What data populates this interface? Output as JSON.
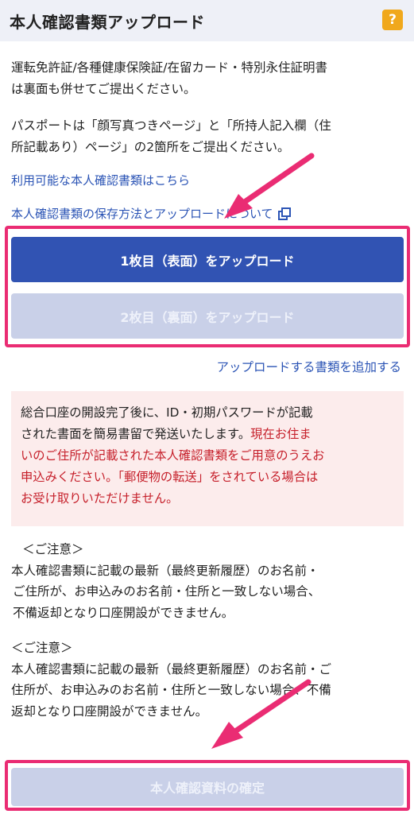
{
  "header": {
    "title": "本人確認書類アップロード",
    "help_icon": "?"
  },
  "intro": {
    "line1": "運転免許証/各種健康保険証/在留カード・特別永住証明書",
    "line2": "は裏面も併せてご提出ください。",
    "line3": "パスポートは「顔写真つきページ」と「所持人記入欄（住",
    "line4": "所記載あり）ページ」の2箇所をご提出ください。"
  },
  "links": {
    "available_docs": "利用可能な本人確認書類はこちら",
    "how_to_upload": "本人確認書類の保存方法とアップロードについて",
    "add_document": "アップロードする書類を追加する"
  },
  "buttons": {
    "upload_front": "1枚目（表面）をアップロード",
    "upload_back": "2枚目（裏面）をアップロード",
    "confirm": "本人確認資料の確定"
  },
  "notice": {
    "line1": "総合口座の開設完了後に、ID・初期パスワードが記載",
    "line2_black": "された書面を簡易書留で発送いたします。",
    "line2_red": "現在お住ま",
    "line3": "いのご住所が記載された本人確認書類をご用意のうえお",
    "line4": "申込みください。「郵便物の転送」をされている場合は",
    "line5": "お受け取りいただけません。"
  },
  "caution1": {
    "heading": "＜ご注意＞",
    "line1": "本人確認書類に記載の最新（最終更新履歴）のお名前・",
    "line2": "ご住所が、お申込みのお名前・住所と一致しない場合、",
    "line3": "不備返却となり口座開設ができません。"
  },
  "caution2": {
    "heading": "＜ご注意＞",
    "line1": "本人確認書類に記載の最新（最終更新履歴）のお名前・ご",
    "line2": "住所が、お申込みのお名前・住所と一致しない場合、不備",
    "line3": "返却となり口座開設ができません。"
  },
  "colors": {
    "primary": "#3153b3",
    "disabled": "#c9d0e8",
    "highlight": "#ea2c73",
    "link": "#2b54b5",
    "warning_red": "#c6202b",
    "help": "#f0a81c"
  }
}
